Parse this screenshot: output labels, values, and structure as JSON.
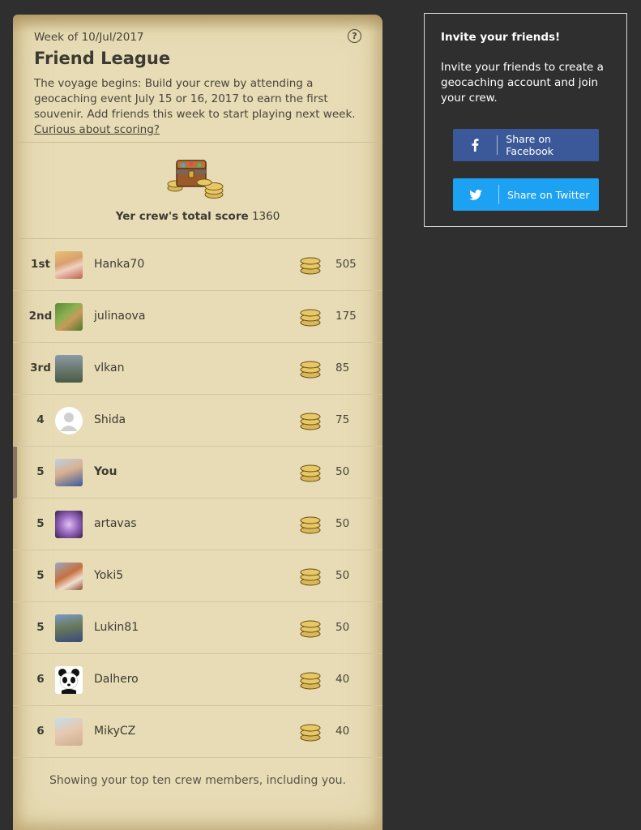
{
  "league": {
    "week": "Week of 10/Jul/2017",
    "title": "Friend League",
    "description": "The voyage begins: Build your crew by attending a geocaching event July 15 or 16, 2017 to earn the first souvenir. Add friends this week to start playing next week.",
    "scoring_link": "Curious about scoring?",
    "crew_label": "Yer crew's total score",
    "crew_score": "1360",
    "footer": "Showing your top ten crew members, including you."
  },
  "members": [
    {
      "rank": "1st",
      "name": "Hanka70",
      "points": "505"
    },
    {
      "rank": "2nd",
      "name": "julinaova",
      "points": "175"
    },
    {
      "rank": "3rd",
      "name": "vlkan",
      "points": "85"
    },
    {
      "rank": "4",
      "name": "Shida",
      "points": "75"
    },
    {
      "rank": "5",
      "name": "You",
      "points": "50"
    },
    {
      "rank": "5",
      "name": "artavas",
      "points": "50"
    },
    {
      "rank": "5",
      "name": "Yoki5",
      "points": "50"
    },
    {
      "rank": "5",
      "name": "Lukin81",
      "points": "50"
    },
    {
      "rank": "6",
      "name": "Dalhero",
      "points": "40"
    },
    {
      "rank": "6",
      "name": "MikyCZ",
      "points": "40"
    }
  ],
  "invite": {
    "title": "Invite your friends!",
    "text": "Invite your friends to create a geocaching account and join your crew.",
    "facebook_label": "Share on Facebook",
    "twitter_label": "Share on Twitter"
  },
  "colors": {
    "background": "#2f2f2f",
    "parchment": "#e7dcb6",
    "facebook": "#3b5998",
    "twitter": "#1da1f2",
    "highlight": "#8a7560"
  }
}
